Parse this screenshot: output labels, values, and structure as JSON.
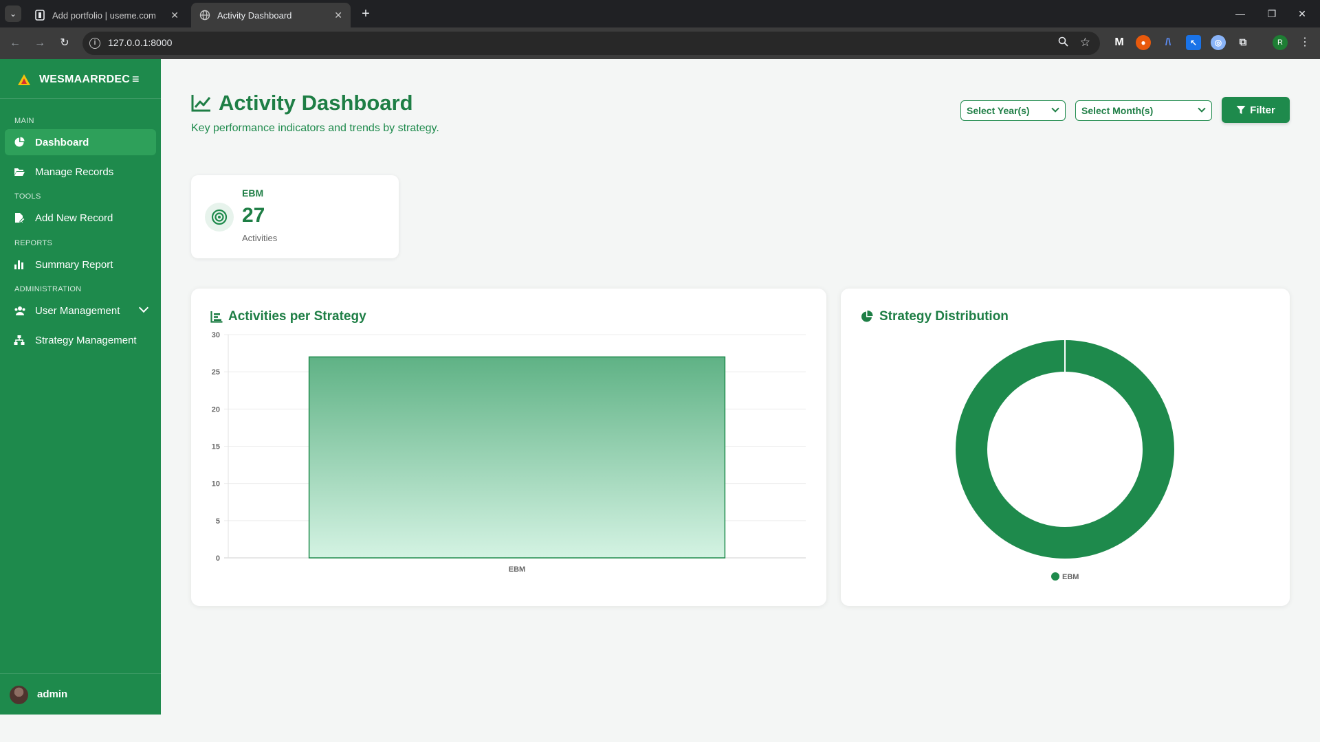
{
  "browser": {
    "tabs": [
      {
        "title": "Add portfolio | useme.com",
        "active": false
      },
      {
        "title": "Activity Dashboard",
        "active": true
      }
    ],
    "url": "127.0.0.1:8000"
  },
  "sidebar": {
    "brand": "WESMAARRDEC",
    "sections": {
      "main": "MAIN",
      "tools": "TOOLS",
      "reports": "REPORTS",
      "administration": "ADMINISTRATION"
    },
    "items": [
      {
        "label": "Dashboard",
        "icon": "chart-pie-icon",
        "active": true
      },
      {
        "label": "Manage Records",
        "icon": "folder-open-icon"
      },
      {
        "label": "Add New Record",
        "icon": "file-add-icon"
      },
      {
        "label": "Summary Report",
        "icon": "bar-chart-icon"
      },
      {
        "label": "User Management",
        "icon": "users-icon"
      },
      {
        "label": "Strategy Management",
        "icon": "sitemap-icon"
      }
    ],
    "user": "admin"
  },
  "header": {
    "title": "Activity Dashboard",
    "subtitle": "Key performance indicators and trends by strategy.",
    "year_select": "Select Year(s)",
    "month_select": "Select Month(s)",
    "filter_label": "Filter"
  },
  "stat": {
    "label": "EBM",
    "value": "27",
    "caption": "Activities"
  },
  "bar_card": {
    "title": "Activities per Strategy"
  },
  "pie_card": {
    "title": "Strategy Distribution"
  },
  "colors": {
    "primary": "#1e8a4c",
    "primary_dark": "#1e7e45",
    "bar_top": "#5fb285",
    "bar_bottom": "#d4f3e3"
  },
  "chart_data": [
    {
      "type": "bar",
      "title": "Activities per Strategy",
      "categories": [
        "EBM"
      ],
      "values": [
        27
      ],
      "ylim": [
        0,
        30
      ],
      "yticks": [
        0,
        5,
        10,
        15,
        20,
        25,
        30
      ],
      "grid": true
    },
    {
      "type": "pie",
      "title": "Strategy Distribution",
      "labels": [
        "EBM"
      ],
      "values": [
        27
      ],
      "donut": true,
      "legend": "bottom"
    }
  ]
}
